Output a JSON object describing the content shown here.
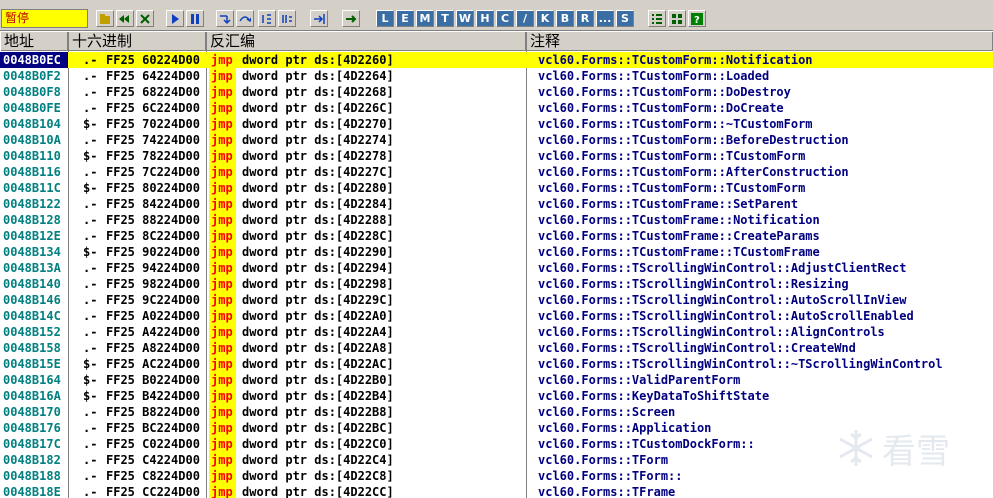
{
  "status": "暂停",
  "columns": [
    "地址",
    "十六进制",
    "反汇编",
    "注释"
  ],
  "toolbar_letters": [
    "L",
    "E",
    "M",
    "T",
    "W",
    "H",
    "C",
    "/",
    "K",
    "B",
    "R",
    "...",
    "S"
  ],
  "rows": [
    {
      "addr": "0048B0EC",
      "mark": ".-",
      "hex": "FF25 60224D00",
      "mn": "jmp",
      "op": "dword ptr ds:[4D2260]",
      "cm": "vcl60.Forms::TCustomForm::Notification",
      "sel": true
    },
    {
      "addr": "0048B0F2",
      "mark": ".-",
      "hex": "FF25 64224D00",
      "mn": "jmp",
      "op": "dword ptr ds:[4D2264]",
      "cm": "vcl60.Forms::TCustomForm::Loaded"
    },
    {
      "addr": "0048B0F8",
      "mark": ".-",
      "hex": "FF25 68224D00",
      "mn": "jmp",
      "op": "dword ptr ds:[4D2268]",
      "cm": "vcl60.Forms::TCustomForm::DoDestroy"
    },
    {
      "addr": "0048B0FE",
      "mark": ".-",
      "hex": "FF25 6C224D00",
      "mn": "jmp",
      "op": "dword ptr ds:[4D226C]",
      "cm": "vcl60.Forms::TCustomForm::DoCreate"
    },
    {
      "addr": "0048B104",
      "mark": "$-",
      "hex": "FF25 70224D00",
      "mn": "jmp",
      "op": "dword ptr ds:[4D2270]",
      "cm": "vcl60.Forms::TCustomForm::~TCustomForm"
    },
    {
      "addr": "0048B10A",
      "mark": ".-",
      "hex": "FF25 74224D00",
      "mn": "jmp",
      "op": "dword ptr ds:[4D2274]",
      "cm": "vcl60.Forms::TCustomForm::BeforeDestruction"
    },
    {
      "addr": "0048B110",
      "mark": "$-",
      "hex": "FF25 78224D00",
      "mn": "jmp",
      "op": "dword ptr ds:[4D2278]",
      "cm": "vcl60.Forms::TCustomForm::TCustomForm"
    },
    {
      "addr": "0048B116",
      "mark": ".-",
      "hex": "FF25 7C224D00",
      "mn": "jmp",
      "op": "dword ptr ds:[4D227C]",
      "cm": "vcl60.Forms::TCustomForm::AfterConstruction"
    },
    {
      "addr": "0048B11C",
      "mark": "$-",
      "hex": "FF25 80224D00",
      "mn": "jmp",
      "op": "dword ptr ds:[4D2280]",
      "cm": "vcl60.Forms::TCustomForm::TCustomForm"
    },
    {
      "addr": "0048B122",
      "mark": ".-",
      "hex": "FF25 84224D00",
      "mn": "jmp",
      "op": "dword ptr ds:[4D2284]",
      "cm": "vcl60.Forms::TCustomFrame::SetParent"
    },
    {
      "addr": "0048B128",
      "mark": ".-",
      "hex": "FF25 88224D00",
      "mn": "jmp",
      "op": "dword ptr ds:[4D2288]",
      "cm": "vcl60.Forms::TCustomFrame::Notification"
    },
    {
      "addr": "0048B12E",
      "mark": ".-",
      "hex": "FF25 8C224D00",
      "mn": "jmp",
      "op": "dword ptr ds:[4D228C]",
      "cm": "vcl60.Forms::TCustomFrame::CreateParams"
    },
    {
      "addr": "0048B134",
      "mark": "$-",
      "hex": "FF25 90224D00",
      "mn": "jmp",
      "op": "dword ptr ds:[4D2290]",
      "cm": "vcl60.Forms::TCustomFrame::TCustomFrame"
    },
    {
      "addr": "0048B13A",
      "mark": ".-",
      "hex": "FF25 94224D00",
      "mn": "jmp",
      "op": "dword ptr ds:[4D2294]",
      "cm": "vcl60.Forms::TScrollingWinControl::AdjustClientRect"
    },
    {
      "addr": "0048B140",
      "mark": ".-",
      "hex": "FF25 98224D00",
      "mn": "jmp",
      "op": "dword ptr ds:[4D2298]",
      "cm": "vcl60.Forms::TScrollingWinControl::Resizing"
    },
    {
      "addr": "0048B146",
      "mark": ".-",
      "hex": "FF25 9C224D00",
      "mn": "jmp",
      "op": "dword ptr ds:[4D229C]",
      "cm": "vcl60.Forms::TScrollingWinControl::AutoScrollInView"
    },
    {
      "addr": "0048B14C",
      "mark": ".-",
      "hex": "FF25 A0224D00",
      "mn": "jmp",
      "op": "dword ptr ds:[4D22A0]",
      "cm": "vcl60.Forms::TScrollingWinControl::AutoScrollEnabled"
    },
    {
      "addr": "0048B152",
      "mark": ".-",
      "hex": "FF25 A4224D00",
      "mn": "jmp",
      "op": "dword ptr ds:[4D22A4]",
      "cm": "vcl60.Forms::TScrollingWinControl::AlignControls"
    },
    {
      "addr": "0048B158",
      "mark": ".-",
      "hex": "FF25 A8224D00",
      "mn": "jmp",
      "op": "dword ptr ds:[4D22A8]",
      "cm": "vcl60.Forms::TScrollingWinControl::CreateWnd"
    },
    {
      "addr": "0048B15E",
      "mark": "$-",
      "hex": "FF25 AC224D00",
      "mn": "jmp",
      "op": "dword ptr ds:[4D22AC]",
      "cm": "vcl60.Forms::TScrollingWinControl::~TScrollingWinControl"
    },
    {
      "addr": "0048B164",
      "mark": "$-",
      "hex": "FF25 B0224D00",
      "mn": "jmp",
      "op": "dword ptr ds:[4D22B0]",
      "cm": "vcl60.Forms::ValidParentForm"
    },
    {
      "addr": "0048B16A",
      "mark": "$-",
      "hex": "FF25 B4224D00",
      "mn": "jmp",
      "op": "dword ptr ds:[4D22B4]",
      "cm": "vcl60.Forms::KeyDataToShiftState"
    },
    {
      "addr": "0048B170",
      "mark": ".-",
      "hex": "FF25 B8224D00",
      "mn": "jmp",
      "op": "dword ptr ds:[4D22B8]",
      "cm": "vcl60.Forms::Screen"
    },
    {
      "addr": "0048B176",
      "mark": ".-",
      "hex": "FF25 BC224D00",
      "mn": "jmp",
      "op": "dword ptr ds:[4D22BC]",
      "cm": "vcl60.Forms::Application"
    },
    {
      "addr": "0048B17C",
      "mark": ".-",
      "hex": "FF25 C0224D00",
      "mn": "jmp",
      "op": "dword ptr ds:[4D22C0]",
      "cm": "vcl60.Forms::TCustomDockForm::"
    },
    {
      "addr": "0048B182",
      "mark": ".-",
      "hex": "FF25 C4224D00",
      "mn": "jmp",
      "op": "dword ptr ds:[4D22C4]",
      "cm": "vcl60.Forms::TForm"
    },
    {
      "addr": "0048B188",
      "mark": ".-",
      "hex": "FF25 C8224D00",
      "mn": "jmp",
      "op": "dword ptr ds:[4D22C8]",
      "cm": "vcl60.Forms::TForm::"
    },
    {
      "addr": "0048B18E",
      "mark": ".-",
      "hex": "FF25 CC224D00",
      "mn": "jmp",
      "op": "dword ptr ds:[4D22CC]",
      "cm": "vcl60.Forms::TFrame"
    }
  ],
  "watermark": "看雪",
  "colors": {
    "selection": "#ffff00",
    "addr_sel_bg": "#000080",
    "mnemonic": "#ff0000",
    "comment": "#000080",
    "address": "#008080"
  }
}
